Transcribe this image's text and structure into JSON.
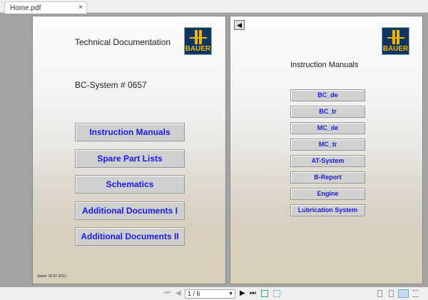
{
  "tab": {
    "title": "Home.pdf",
    "close": "×"
  },
  "page1": {
    "title": "Technical Documentation",
    "system": "BC-System # 0657",
    "logo": "BAUER",
    "date": "Stand: 02.07.2012",
    "buttons": [
      "Instruction Manuals",
      "Spare Part Lists",
      "Schematics",
      "Additional Documents I",
      "Additional Documents II"
    ]
  },
  "page2": {
    "title": "Instruction Manuals",
    "logo": "BAUER",
    "back": "◀",
    "buttons": [
      "BC_de",
      "BC_tr",
      "MC_de",
      "MC_tr",
      "AT-System",
      "B-Report",
      "Engine",
      "Lubrication System"
    ]
  },
  "toolbar": {
    "page": "1 / 6",
    "first": "⏮",
    "prev": "◀",
    "next": "▶",
    "last": "⏭"
  }
}
